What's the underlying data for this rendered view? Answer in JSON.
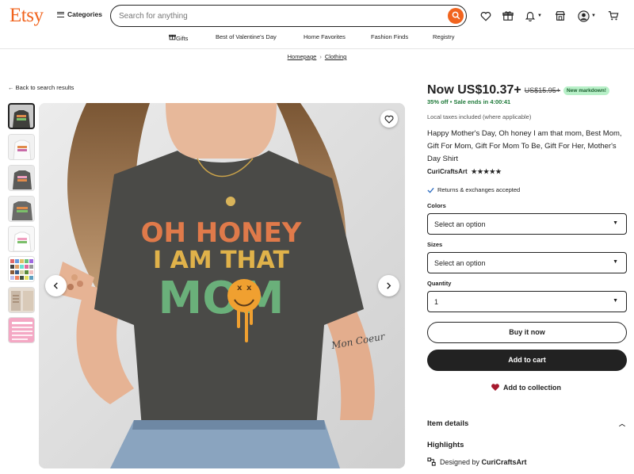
{
  "header": {
    "logo": "Etsy",
    "categories_label": "Categories",
    "search_placeholder": "Search for anything",
    "nav": [
      "Gifts",
      "Best of Valentine's Day",
      "Home Favorites",
      "Fashion Finds",
      "Registry"
    ]
  },
  "breadcrumb": [
    "Homepage",
    "Clothing"
  ],
  "back_link": "Back to search results",
  "gallery": {
    "shirt_text_line1": "OH HONEY",
    "shirt_text_line2": "I AM THAT",
    "shirt_text_line3": "MOM",
    "tattoo_text": "Mon Coeur"
  },
  "product": {
    "price_now": "Now US$10.37+",
    "price_old": "US$15.95+",
    "badge": "New markdown!",
    "sale_info": "35% off • Sale ends in 4:00:41",
    "taxes": "Local taxes included (where applicable)",
    "title": "Happy Mother's Day, Oh honey I am that mom, Best Mom, Gift For Mom, Gift For Mom To Be, Gift For Her, Mother's Day Shirt",
    "shop_name": "CuriCraftsArt",
    "rating": 4.5,
    "stars": "★★★★★",
    "returns": "Returns & exchanges accepted"
  },
  "options": {
    "colors_label": "Colors",
    "colors_value": "Select an option",
    "sizes_label": "Sizes",
    "sizes_value": "Select an option",
    "quantity_label": "Quantity",
    "quantity_value": "1"
  },
  "actions": {
    "buy_now": "Buy it now",
    "add_to_cart": "Add to cart",
    "add_to_collection": "Add to collection"
  },
  "details": {
    "item_details": "Item details",
    "highlights": "Highlights",
    "designed_by_prefix": "Designed by ",
    "designed_by_shop": "CuriCraftsArt"
  },
  "colors": {
    "brand": "#f1641e",
    "sale_green": "#1f7a3a",
    "badge_bg": "#b8f0c8",
    "heart_red": "#a61a2e"
  }
}
